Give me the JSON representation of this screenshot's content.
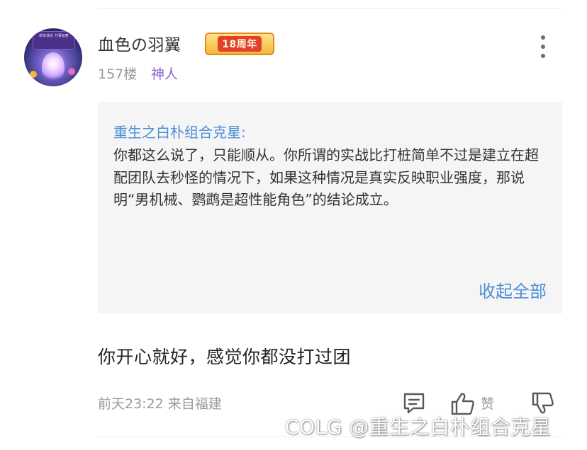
{
  "post": {
    "username": "血色の羽翼",
    "badge": "18周年",
    "floor": "157楼",
    "user_title": "神人",
    "avatar_banner": "新年快乐 万事如意"
  },
  "quote": {
    "author": "重生之白朴组合克星:",
    "body": "你都这么说了，只能顺从。你所谓的实战比打桩简单不过是建立在超配团队去秒怪的情况下，如果这种情况是真实反映职业强度，那说明“男机械、鹦鹉是超性能角色”的结论成立。",
    "collapse_label": "收起全部"
  },
  "reply": {
    "text": "你开心就好，感觉你都没打过团"
  },
  "footer": {
    "time_location": "前天23:22 来自福建",
    "like_label": "赞"
  },
  "watermark": {
    "text": "COLG @重生之白朴组合克星"
  },
  "colors": {
    "link_blue": "#4f8fd8",
    "title_purple": "#8a63d2",
    "quote_bg": "#f5f5f5",
    "meta_gray": "#9a9a9a"
  },
  "icons": {
    "more": "more-vertical-icon",
    "comment": "comment-icon",
    "like": "thumbs-up-icon",
    "dislike": "thumbs-down-icon"
  }
}
